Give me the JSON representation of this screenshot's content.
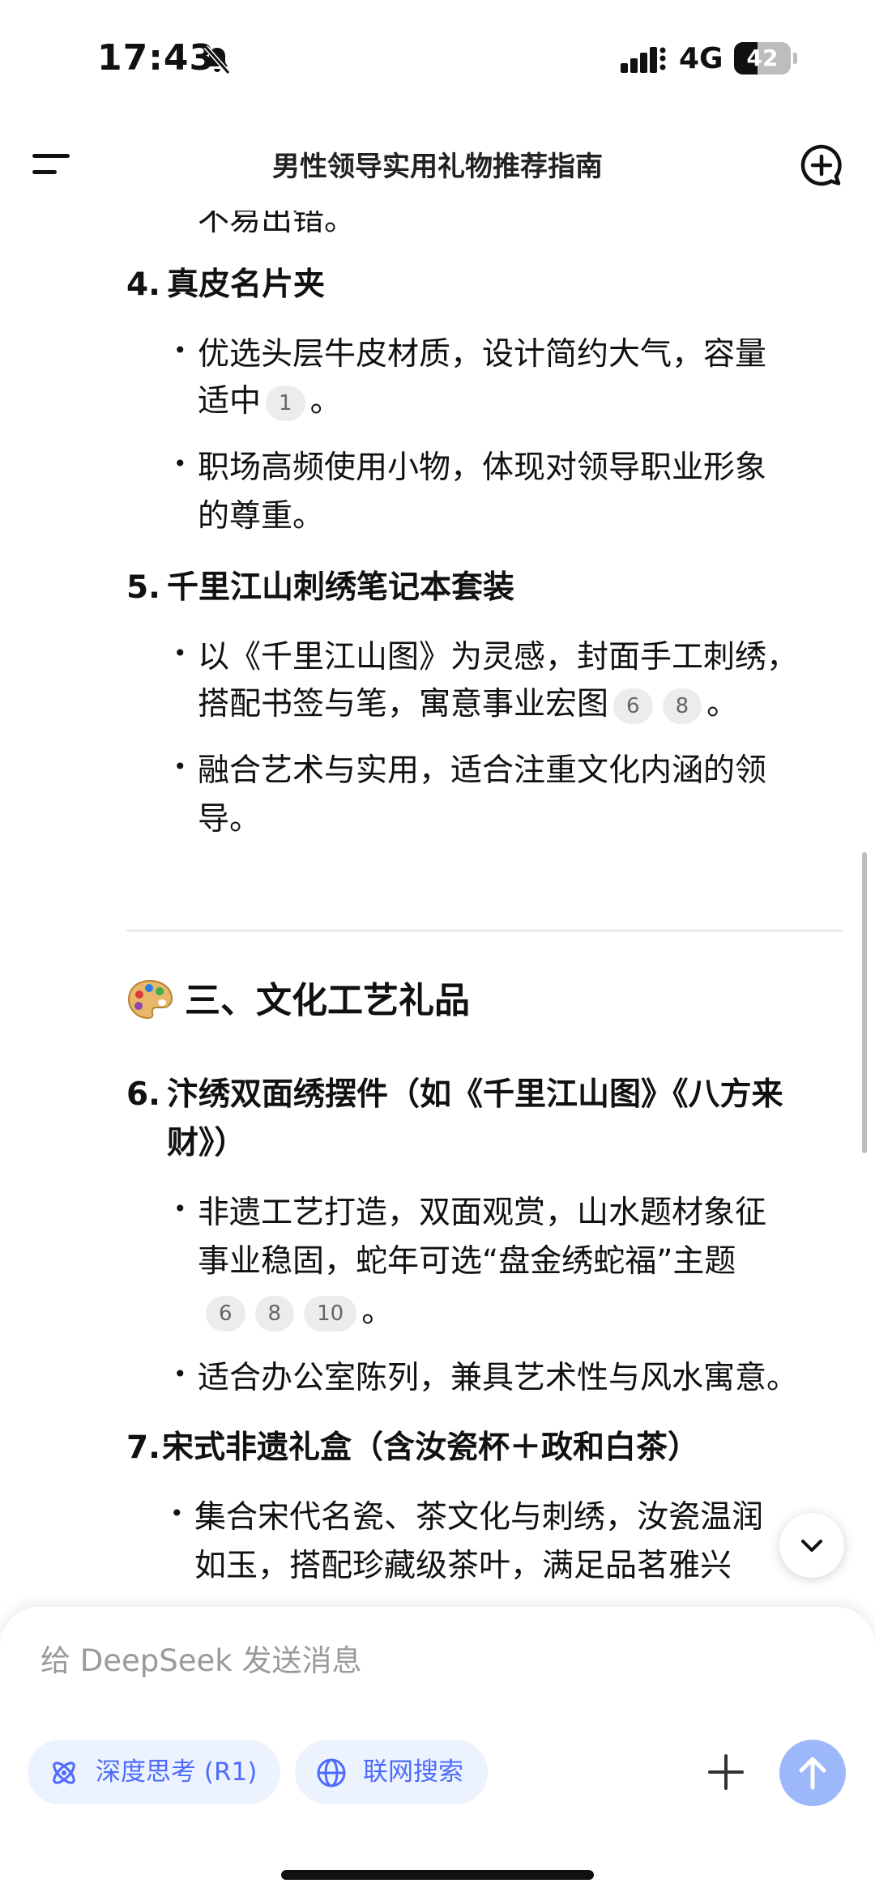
{
  "status_bar": {
    "time": "17:43",
    "network": "4G",
    "battery": "42"
  },
  "nav": {
    "title": "男性领导实用礼物推荐指南"
  },
  "content": {
    "partial_line": "不易出错。",
    "item4": {
      "number": "4.",
      "title": "真皮名片夹",
      "bullet1_l1": "优选头层牛皮材质，设计简约大气，容量",
      "bullet1_l2": "适中",
      "bullet1_cites": [
        "1"
      ],
      "bullet1_end": "。",
      "bullet2_l1": "职场高频使用小物，体现对领导职业形象",
      "bullet2_l2": "的尊重。"
    },
    "item5": {
      "number": "5.",
      "title": "千里江山刺绣笔记本套装",
      "bullet1_l1": "以《千里江山图》为灵感，封面手工刺绣，",
      "bullet1_l2": "搭配书签与笔，寓意事业宏图",
      "bullet1_cites": [
        "6",
        "8"
      ],
      "bullet1_end": "。",
      "bullet2_l1": "融合艺术与实用，适合注重文化内涵的领",
      "bullet2_l2": "导。"
    },
    "section3": {
      "title": "三、文化工艺礼品",
      "icon": "palette-emoji"
    },
    "item6": {
      "number": "6.",
      "title_l1": "汴绣双面绣摆件（如《千里江山图》《八方来",
      "title_l2": "财》）",
      "bullet1_l1": "非遗工艺打造，双面观赏，山水题材象征",
      "bullet1_l2": "事业稳固，蛇年可选“盘金绣蛇福”主题",
      "bullet1_cites": [
        "6",
        "8",
        "10"
      ],
      "bullet1_end": "。",
      "bullet2_l1": "适合办公室陈列，兼具艺术性与风水寓意。"
    },
    "item7": {
      "number": "7.",
      "title": "宋式非遗礼盒（含汝瓷杯＋政和白茶）",
      "bullet1_l1": "集合宋代名瓷、茶文化与刺绣，汝瓷温润",
      "bullet1_l2": "如玉，搭配珍藏级茶叶，满足品茗雅兴"
    }
  },
  "composer": {
    "placeholder": "给 DeepSeek 发送消息",
    "deep_think_label": "深度思考 (R1)",
    "web_search_label": "联网搜索"
  },
  "colors": {
    "accent": "#4d6bfe",
    "pill_bg": "#edf3fe",
    "send_bg": "#9db7fb"
  }
}
